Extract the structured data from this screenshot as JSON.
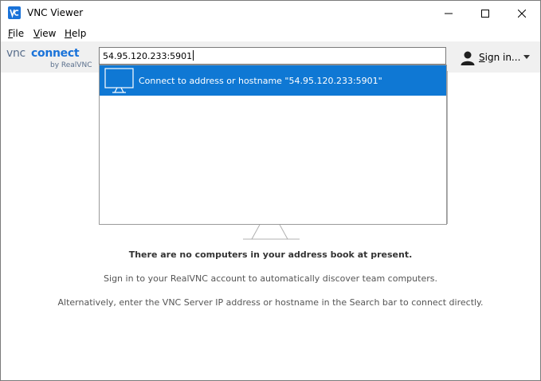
{
  "window": {
    "title": "VNC Viewer"
  },
  "menu": {
    "file": "File",
    "view": "View",
    "help": "Help"
  },
  "toolbar": {
    "search_value": "54.95.120.233:5901",
    "signin_label": "Sign in..."
  },
  "logo": {
    "line1": "VNC CONNECT",
    "line2": "by RealVNC"
  },
  "dropdown": {
    "item_label": "Connect to address or hostname \"54.95.120.233:5901\""
  },
  "content": {
    "empty_title": "There are no computers in your address book at present.",
    "signin_hint": "Sign in to your RealVNC account to automatically discover team computers.",
    "alt_hint": "Alternatively, enter the VNC Server IP address or hostname in the Search bar to connect directly."
  },
  "colors": {
    "accent": "#0f78d4",
    "title_bar": "#ffffff",
    "toolbar": "#f0f0f0"
  },
  "icons": [
    "vnc-viewer-app-icon",
    "minimize-icon",
    "maximize-icon",
    "close-icon",
    "user-icon",
    "chevron-down-icon",
    "monitor-icon"
  ]
}
